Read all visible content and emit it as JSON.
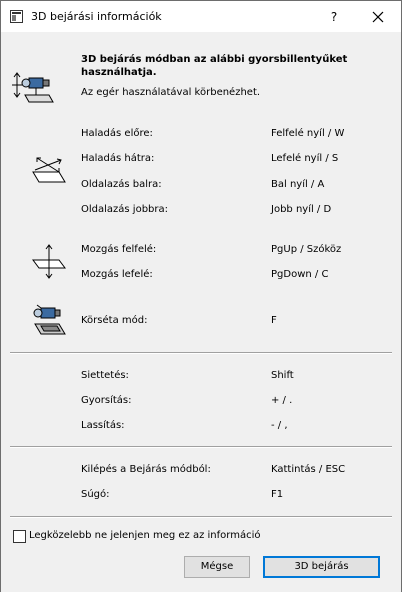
{
  "title": "3D bejárási információk",
  "help_label": "?",
  "intro": {
    "heading": "3D bejárás módban az alábbi gyorsbillentyűket használhatja.",
    "heading_line1": "3D bejárás módban az alábbi gyorsbillentyűket",
    "heading_line2": "használhatja.",
    "subtext": "Az egér használatával körbenézhet."
  },
  "movement": [
    {
      "label": "Haladás előre:",
      "key": "Felfelé nyíl / W"
    },
    {
      "label": "Haladás hátra:",
      "key": "Lefelé nyíl / S"
    },
    {
      "label": "Oldalazás balra:",
      "key": "Bal nyíl / A"
    },
    {
      "label": "Oldalazás jobbra:",
      "key": "Jobb nyíl / D"
    }
  ],
  "vertical": [
    {
      "label": "Mozgás felfelé:",
      "key": "PgUp / Szóköz"
    },
    {
      "label": "Mozgás lefelé:",
      "key": "PgDown / C"
    }
  ],
  "tour": {
    "label": "Körséta mód:",
    "key": "F"
  },
  "speed": [
    {
      "label": "Siettetés:",
      "key": "Shift"
    },
    {
      "label": "Gyorsítás:",
      "key": "+ / ."
    },
    {
      "label": "Lassítás:",
      "key": "- / ,"
    }
  ],
  "misc": [
    {
      "label": "Kilépés a Bejárás módból:",
      "key": "Kattintás / ESC"
    },
    {
      "label": "Súgó:",
      "key": "F1"
    }
  ],
  "checkbox_label": "Legközelebb ne jelenjen meg ez az információ",
  "buttons": {
    "cancel": "Mégse",
    "walk": "3D bejárás"
  },
  "colors": {
    "accent": "#0078d7",
    "background": "#f0f0f0"
  }
}
